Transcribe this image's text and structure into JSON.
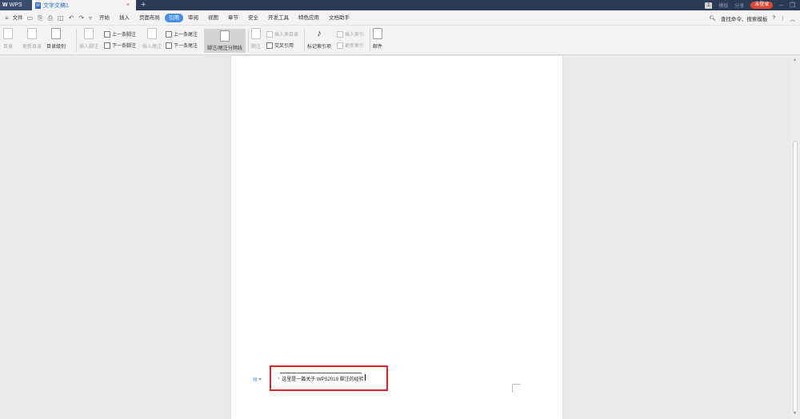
{
  "titlebar": {
    "app_label": "WPS",
    "doc_tab": "文字文稿1",
    "close_glyph": "×",
    "add_tab": "+",
    "right_badge": "1",
    "right_items": [
      "模板",
      "分享"
    ],
    "login_label": "未登录"
  },
  "menubar": {
    "file_label": "文件",
    "tabs": [
      "开始",
      "插入",
      "页面布局",
      "引用",
      "审阅",
      "视图",
      "章节",
      "安全",
      "开发工具",
      "特色应用",
      "文档助手"
    ],
    "active_tab": "引用",
    "search_label": "查找命令、搜索模板",
    "help": "?"
  },
  "ribbon": {
    "toc": "目录",
    "update_toc": "更新目录",
    "toc_level": "目录级别",
    "insert_footnote": "插入脚注",
    "prev_footnote": "上一条脚注",
    "next_footnote": "下一条脚注",
    "insert_endnote": "插入尾注",
    "prev_endnote": "上一条尾注",
    "next_endnote": "下一条尾注",
    "footnote_separator": "脚注/尾注分隔线",
    "caption": "题注",
    "insert_caption": "插入表目录",
    "cross_reference": "交叉引用",
    "mark_index": "标记索引项",
    "insert_index": "插入索引",
    "update_index": "更新索引",
    "mail": "邮件"
  },
  "document": {
    "footnote_mark": "1",
    "footnote_text": "这里是一篇关于 WPS2019 脚注的经验"
  },
  "colors": {
    "active_tab": "#4a90e2",
    "highlight_box": "#e0212a",
    "login": "#e0453a"
  }
}
